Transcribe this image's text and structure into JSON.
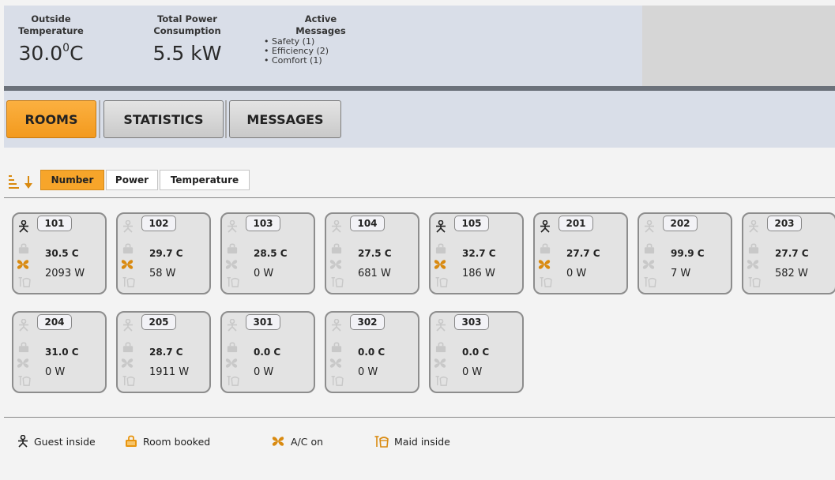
{
  "header": {
    "outside_temperature": {
      "title_line1": "Outside",
      "title_line2": "Temperature",
      "value": "30.0",
      "unit_sup": "0",
      "unit": "C"
    },
    "total_power": {
      "title_line1": "Total Power",
      "title_line2": "Consumption",
      "value": "5.5 kW"
    },
    "active_messages": {
      "title_line1": "Active",
      "title_line2": "Messages",
      "items": [
        "Safety (1)",
        "Efficiency (2)",
        "Comfort (1)"
      ]
    }
  },
  "tabs": [
    {
      "label": "ROOMS",
      "active": true
    },
    {
      "label": "STATISTICS",
      "active": false
    },
    {
      "label": "MESSAGES",
      "active": false
    }
  ],
  "sort": {
    "icon": "sort-descending-icon",
    "options": [
      {
        "label": "Number",
        "active": true
      },
      {
        "label": "Power",
        "active": false
      },
      {
        "label": "Temperature",
        "active": false
      }
    ]
  },
  "rooms": [
    {
      "number": "101",
      "temp": "30.5 C",
      "power": "2093 W",
      "guest": true,
      "booked": false,
      "ac": true,
      "maid": false
    },
    {
      "number": "102",
      "temp": "29.7 C",
      "power": "58 W",
      "guest": false,
      "booked": false,
      "ac": true,
      "maid": false
    },
    {
      "number": "103",
      "temp": "28.5 C",
      "power": "0 W",
      "guest": false,
      "booked": false,
      "ac": false,
      "maid": false
    },
    {
      "number": "104",
      "temp": "27.5 C",
      "power": "681 W",
      "guest": false,
      "booked": false,
      "ac": false,
      "maid": false
    },
    {
      "number": "105",
      "temp": "32.7 C",
      "power": "186 W",
      "guest": true,
      "booked": false,
      "ac": true,
      "maid": false
    },
    {
      "number": "201",
      "temp": "27.7 C",
      "power": "0 W",
      "guest": true,
      "booked": false,
      "ac": true,
      "maid": false
    },
    {
      "number": "202",
      "temp": "99.9 C",
      "power": "7 W",
      "guest": false,
      "booked": false,
      "ac": false,
      "maid": false
    },
    {
      "number": "203",
      "temp": "27.7 C",
      "power": "582 W",
      "guest": false,
      "booked": false,
      "ac": false,
      "maid": false
    },
    {
      "number": "204",
      "temp": "31.0 C",
      "power": "0 W",
      "guest": false,
      "booked": false,
      "ac": false,
      "maid": false
    },
    {
      "number": "205",
      "temp": "28.7 C",
      "power": "1911 W",
      "guest": false,
      "booked": false,
      "ac": false,
      "maid": false
    },
    {
      "number": "301",
      "temp": "0.0 C",
      "power": "0 W",
      "guest": false,
      "booked": false,
      "ac": false,
      "maid": false
    },
    {
      "number": "302",
      "temp": "0.0 C",
      "power": "0 W",
      "guest": false,
      "booked": false,
      "ac": false,
      "maid": false
    },
    {
      "number": "303",
      "temp": "0.0 C",
      "power": "0 W",
      "guest": false,
      "booked": false,
      "ac": false,
      "maid": false
    }
  ],
  "legend": [
    {
      "icon": "guest-icon",
      "label": "Guest inside"
    },
    {
      "icon": "booked-icon",
      "label": "Room booked"
    },
    {
      "icon": "ac-fan-icon",
      "label": "A/C on"
    },
    {
      "icon": "maid-icon",
      "label": "Maid inside"
    }
  ],
  "colors": {
    "accent": "#f7a52a",
    "icon_active": "#222222",
    "icon_inactive": "#c8c8c8",
    "booked": "#e8950f",
    "ac_active": "#d98a10"
  }
}
